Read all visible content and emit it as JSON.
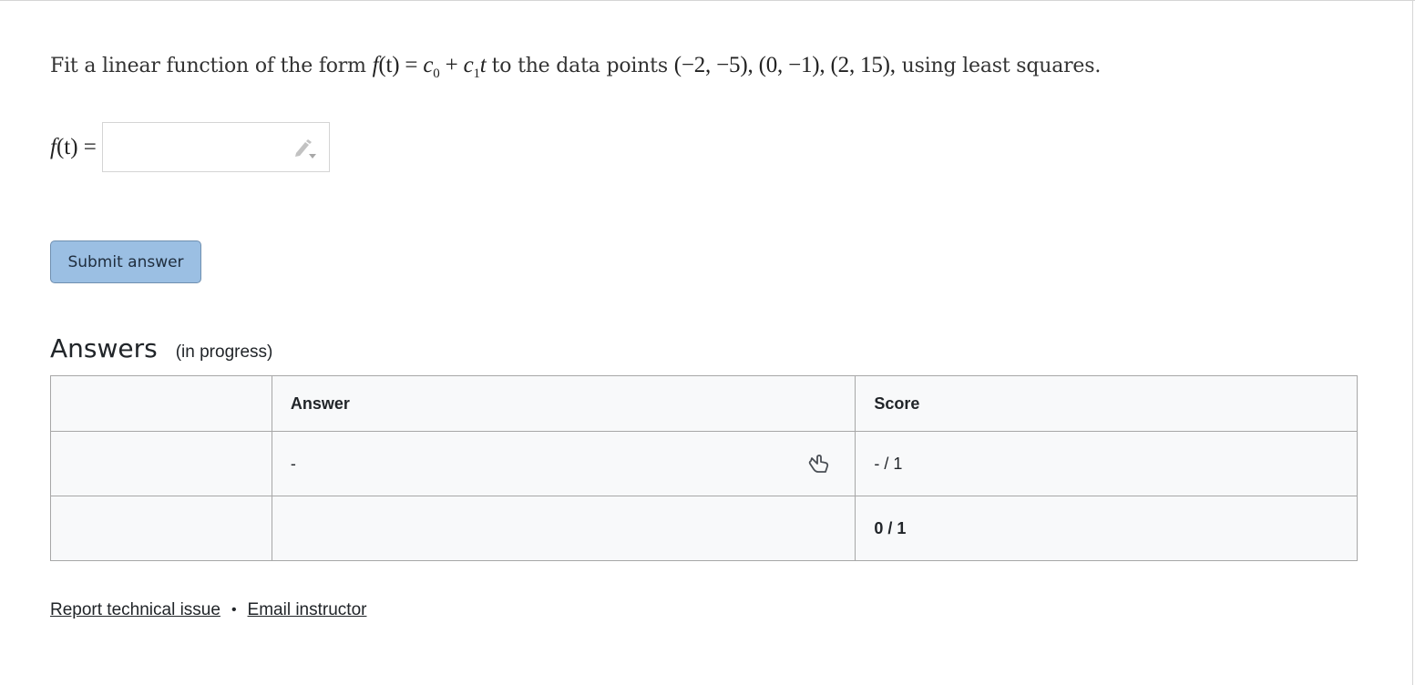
{
  "question": {
    "text_prefix": "Fit a linear function of the form",
    "formula_f": "f",
    "formula_t": "(t)",
    "formula_eq": " = ",
    "formula_c0": "c",
    "formula_c0_sub": "0",
    "formula_plus": " + ",
    "formula_c1": "c",
    "formula_c1_sub": "1",
    "formula_c1_t": "t",
    "text_middle": "to the data points",
    "points": "(−2, −5), (0, −1), (2, 15),",
    "text_suffix": "using least squares."
  },
  "answer_input": {
    "label_f": "f",
    "label_rest": "(t) =",
    "value": "",
    "icon": "pencil-dropdown-icon"
  },
  "submit": {
    "label": "Submit answer"
  },
  "answers": {
    "title": "Answers",
    "status": "(in progress)",
    "table": {
      "headers": [
        "",
        "Answer",
        "Score"
      ],
      "rows": [
        {
          "col1": "",
          "answer": "-",
          "score": "- / 1",
          "icon": "hand-pointer-icon"
        },
        {
          "col1": "",
          "answer": "",
          "score": "0 / 1"
        }
      ]
    }
  },
  "footer": {
    "report_link": "Report technical issue",
    "separator": "•",
    "email_link": "Email instructor"
  }
}
